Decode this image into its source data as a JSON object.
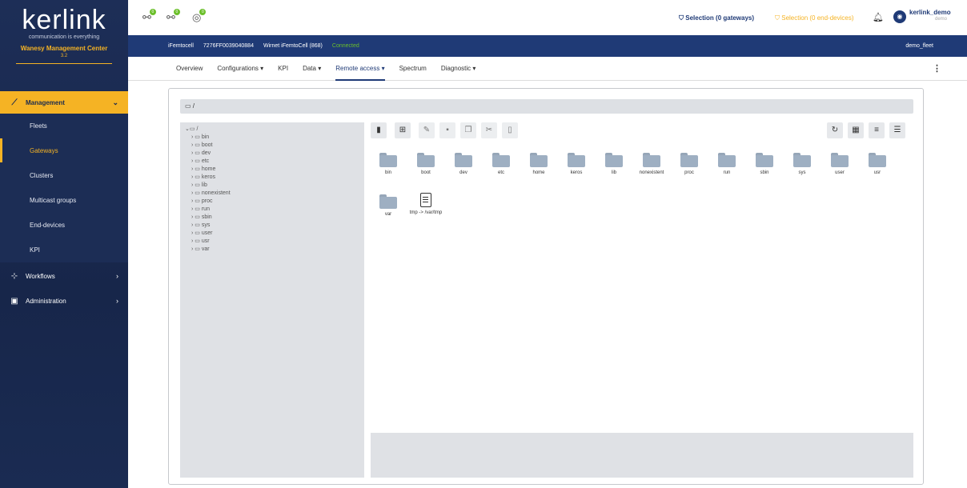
{
  "sidebar": {
    "brand": "kerlink",
    "tagline": "communication is everything",
    "product": "Wanesy Management Center",
    "version": "3.2",
    "sections": [
      {
        "label": "Management",
        "icon": "chart-line-icon"
      },
      {
        "label": "Workflows",
        "icon": "workflow-icon"
      },
      {
        "label": "Administration",
        "icon": "admin-icon"
      }
    ],
    "items": [
      {
        "label": "Fleets"
      },
      {
        "label": "Gateways"
      },
      {
        "label": "Clusters"
      },
      {
        "label": "Multicast groups"
      },
      {
        "label": "End-devices"
      },
      {
        "label": "KPI"
      }
    ]
  },
  "header": {
    "badges": [
      "0",
      "0",
      "0"
    ],
    "selection_gateways": "Selection (0 gateways)",
    "selection_end_devices": "Selection (0 end-devices)",
    "user_name": "kerlink_demo",
    "user_sub": "demo"
  },
  "gateway_bar": {
    "name": "iFemtocell",
    "eui": "7276FF0039040884",
    "model": "Wirnet iFemtoCell (868)",
    "status": "Connected",
    "fleet": "demo_fleet"
  },
  "tabs": [
    {
      "label": "Overview"
    },
    {
      "label": "Configurations ▾"
    },
    {
      "label": "KPI"
    },
    {
      "label": "Data ▾"
    },
    {
      "label": "Remote access ▾"
    },
    {
      "label": "Spectrum"
    },
    {
      "label": "Diagnostic ▾"
    }
  ],
  "explorer": {
    "path": "/",
    "tree_root": "/",
    "tree": [
      "bin",
      "boot",
      "dev",
      "etc",
      "home",
      "keros",
      "lib",
      "nonexistent",
      "proc",
      "run",
      "sbin",
      "sys",
      "user",
      "usr",
      "var"
    ],
    "files": [
      {
        "name": "bin",
        "type": "folder"
      },
      {
        "name": "boot",
        "type": "folder"
      },
      {
        "name": "dev",
        "type": "folder"
      },
      {
        "name": "etc",
        "type": "folder"
      },
      {
        "name": "home",
        "type": "folder"
      },
      {
        "name": "keros",
        "type": "folder"
      },
      {
        "name": "lib",
        "type": "folder"
      },
      {
        "name": "nonexistent",
        "type": "folder"
      },
      {
        "name": "proc",
        "type": "folder"
      },
      {
        "name": "run",
        "type": "folder"
      },
      {
        "name": "sbin",
        "type": "folder"
      },
      {
        "name": "sys",
        "type": "folder"
      },
      {
        "name": "user",
        "type": "folder"
      },
      {
        "name": "usr",
        "type": "folder"
      },
      {
        "name": "var",
        "type": "folder"
      },
      {
        "name": "tmp -> /var/tmp",
        "type": "file"
      }
    ]
  },
  "colors": {
    "accent": "#f5b324",
    "navy": "#1f3a76",
    "status_ok": "#6bbf2a"
  }
}
